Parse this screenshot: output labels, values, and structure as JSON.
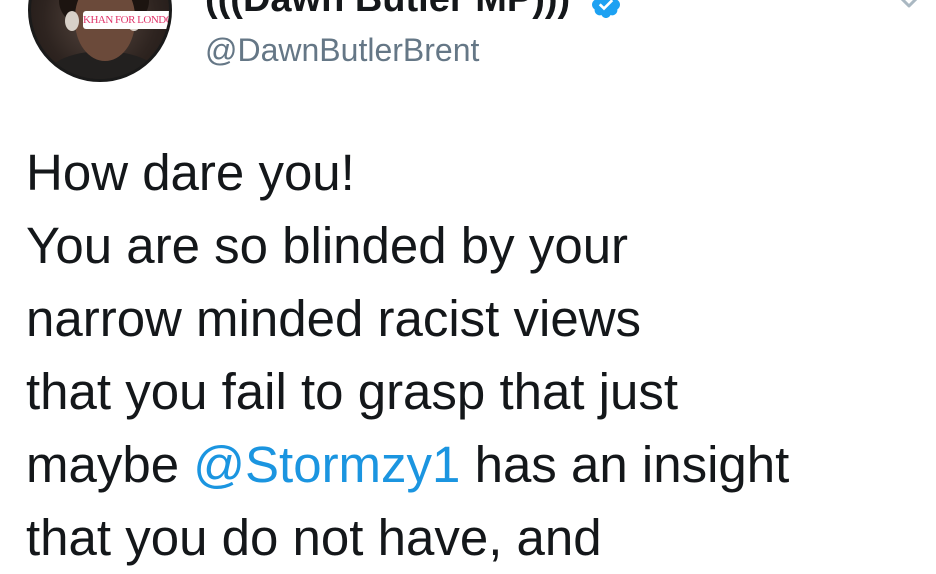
{
  "profile": {
    "display_name": "(((Dawn Butler MP)))",
    "handle": "@DawnButlerBrent",
    "avatar_banner_text": "KHAN FOR LONDON"
  },
  "tweet": {
    "line1": "How dare you!",
    "line2": "You are so blinded by your",
    "line3": "narrow minded racist views",
    "line4": "that you fail to grasp that just",
    "line5_before": "maybe ",
    "line5_mention": "@Stormzy1",
    "line5_after": " has an insight",
    "line6": "that you do not have, and"
  },
  "colors": {
    "text": "#14171a",
    "handle": "#657786",
    "mention": "#1b95e0",
    "verified": "#1da1f2"
  },
  "icons": {
    "verified": "verified-badge-icon",
    "menu": "chevron-down-icon"
  }
}
